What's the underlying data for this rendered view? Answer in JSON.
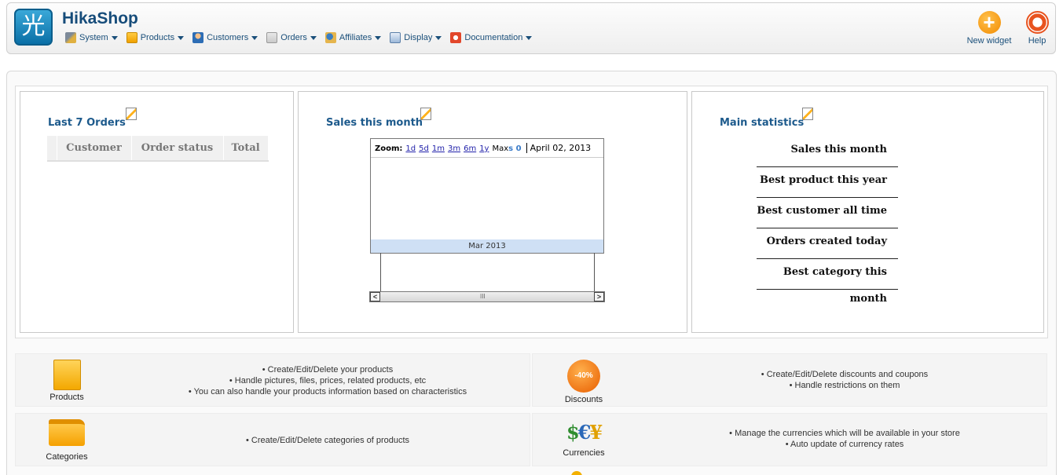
{
  "app": {
    "logo_glyph": "光",
    "title": "HikaShop"
  },
  "menu": [
    {
      "label": "System",
      "icon": "tools-icon"
    },
    {
      "label": "Products",
      "icon": "box-icon"
    },
    {
      "label": "Customers",
      "icon": "users-icon"
    },
    {
      "label": "Orders",
      "icon": "orders-icon"
    },
    {
      "label": "Affiliates",
      "icon": "affiliates-icon"
    },
    {
      "label": "Display",
      "icon": "display-icon"
    },
    {
      "label": "Documentation",
      "icon": "lifebuoy-icon"
    }
  ],
  "actions": {
    "new_widget": "New widget",
    "new_widget_glyph": "+",
    "help": "Help"
  },
  "widgets": {
    "orders": {
      "title": "Last 7 Orders",
      "columns": [
        "",
        "Customer",
        "Order status",
        "Total"
      ]
    },
    "sales": {
      "title": "Sales this month",
      "zoom_label": "Zoom:",
      "zoom_options": [
        "1d",
        "5d",
        "1m",
        "3m",
        "6m",
        "1y"
      ],
      "zoom_max": "Max",
      "zoom_extra": "s 0",
      "current_date": "April 02, 2013",
      "month_label": "Mar 2013",
      "scroll_left": "<",
      "scroll_right": ">",
      "scroll_thumb": "III"
    },
    "stats": {
      "title": "Main statistics",
      "rows": [
        "Sales this month",
        "Best product this year",
        "Best customer all time",
        "Orders created today",
        "Best category this month"
      ]
    }
  },
  "panels": {
    "products": {
      "label": "Products",
      "lines": [
        "Create/Edit/Delete your products",
        "Handle pictures, files, prices, related products, etc",
        "You can also handle your products information based on characteristics"
      ]
    },
    "discounts": {
      "label": "Discounts",
      "badge": "-40%",
      "lines": [
        "Create/Edit/Delete discounts and coupons",
        "Handle restrictions on them"
      ]
    },
    "categories": {
      "label": "Categories",
      "lines": [
        "Create/Edit/Delete categories of products"
      ]
    },
    "currencies": {
      "label": "Currencies",
      "symbols": [
        "$",
        "€",
        "¥"
      ],
      "lines": [
        "Manage the currencies which will be available in your store",
        "Auto update of currency rates"
      ]
    }
  }
}
